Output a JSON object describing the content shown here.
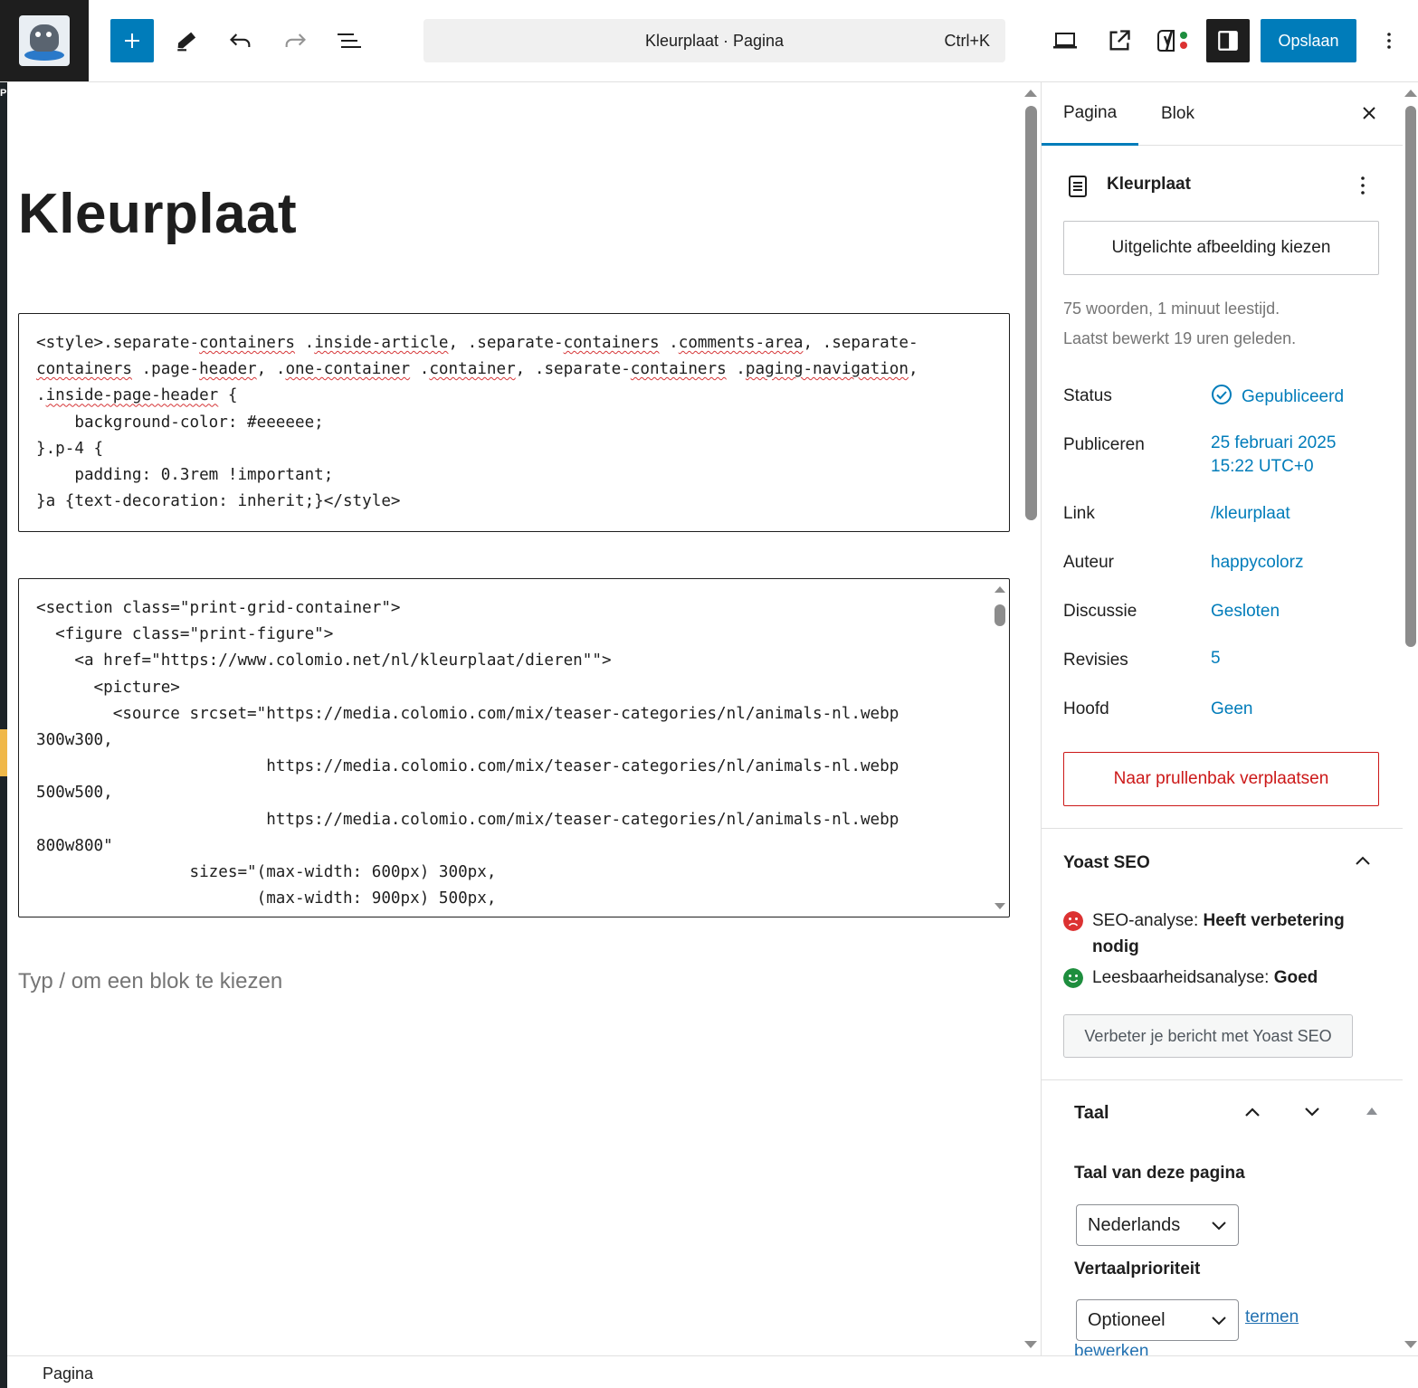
{
  "admin_strip": {
    "glyphs": "PPPSRDPD[ECVmEDEshNEWEDrJyr"
  },
  "toolbar": {
    "add_block_label": "Voeg blok toe",
    "document_title": "Kleurplaat · Pagina",
    "shortcut": "Ctrl+K",
    "save_label": "Opslaan"
  },
  "editor": {
    "page_title": "Kleurplaat",
    "code_block_1": [
      [
        {
          "t": "<style>.separate-"
        },
        {
          "t": "containers",
          "s": 1
        },
        {
          "t": " ."
        },
        {
          "t": "inside-article",
          "s": 1
        },
        {
          "t": ", .separate-"
        },
        {
          "t": "containers",
          "s": 1
        },
        {
          "t": " ."
        },
        {
          "t": "comments-area",
          "s": 1
        },
        {
          "t": ", .separate-"
        }
      ],
      [
        {
          "t": "containers",
          "s": 1
        },
        {
          "t": " .page-"
        },
        {
          "t": "header",
          "s": 1
        },
        {
          "t": ", ."
        },
        {
          "t": "one-container",
          "s": 1
        },
        {
          "t": " ."
        },
        {
          "t": "container",
          "s": 1
        },
        {
          "t": ", .separate-"
        },
        {
          "t": "containers",
          "s": 1
        },
        {
          "t": " ."
        },
        {
          "t": "paging-navigation",
          "s": 1
        },
        {
          "t": ","
        }
      ],
      [
        {
          "t": "."
        },
        {
          "t": "inside-page-header",
          "s": 1
        },
        {
          "t": " {"
        }
      ],
      [
        {
          "t": "    background-color: #eeeeee;"
        }
      ],
      [
        {
          "t": "}.p-4 {"
        }
      ],
      [
        {
          "t": "    padding: 0.3rem !important;"
        }
      ],
      [
        {
          "t": "}a {text-decoration: inherit;}</style>"
        }
      ]
    ],
    "code_block_2": [
      "<section class=\"print-grid-container\">",
      "  <figure class=\"print-figure\">",
      "    <a href=\"https://www.colomio.net/nl/kleurplaat/dieren\"\">",
      "      <picture>",
      "        <source srcset=\"https://media.colomio.com/mix/teaser-categories/nl/animals-nl.webp",
      "300w300,",
      "                        https://media.colomio.com/mix/teaser-categories/nl/animals-nl.webp",
      "500w500,",
      "                        https://media.colomio.com/mix/teaser-categories/nl/animals-nl.webp",
      "800w800\"",
      "                sizes=\"(max-width: 600px) 300px,",
      "                       (max-width: 900px) 500px,"
    ],
    "placeholder": "Typ / om een blok te kiezen"
  },
  "sidebar": {
    "tabs": [
      "Pagina",
      "Blok"
    ],
    "doc_title": "Kleurplaat",
    "featured_image_button": "Uitgelichte afbeelding kiezen",
    "word_count": "75 woorden, 1 minuut leestijd.",
    "last_edited": "Laatst bewerkt 19 uren geleden.",
    "properties": [
      {
        "label": "Status",
        "value": "Gepubliceerd"
      },
      {
        "label": "Publiceren",
        "value": "25 februari 2025",
        "value2": "15:22 UTC+0"
      },
      {
        "label": "Link",
        "value": "/kleurplaat"
      },
      {
        "label": "Auteur",
        "value": "happycolorz"
      },
      {
        "label": "Discussie",
        "value": "Gesloten"
      },
      {
        "label": "Revisies",
        "value": "5"
      },
      {
        "label": "Hoofd",
        "value": "Geen"
      }
    ],
    "trash_button": "Naar prullenbak verplaatsen",
    "yoast": {
      "title": "Yoast SEO",
      "seo_label": "SEO-analyse: ",
      "seo_value": "Heeft verbetering nodig",
      "read_label": "Leesbaarheidsanalyse: ",
      "read_value": "Goed",
      "button": "Verbeter je bericht met Yoast SEO"
    },
    "taal": {
      "title": "Taal",
      "page_lang_label": "Taal van deze pagina",
      "page_lang_value": "Nederlands",
      "priority_label": "Vertaalprioriteit",
      "priority_value": "Optioneel",
      "edit_terms": "termen",
      "edit_terms_2": "bewerken"
    }
  },
  "footer": {
    "breadcrumb": "Pagina"
  },
  "colors": {
    "accent": "#007cba",
    "danger": "#cc1818",
    "seo_bad": "#dc3232",
    "seo_good": "#1e8e3e"
  }
}
